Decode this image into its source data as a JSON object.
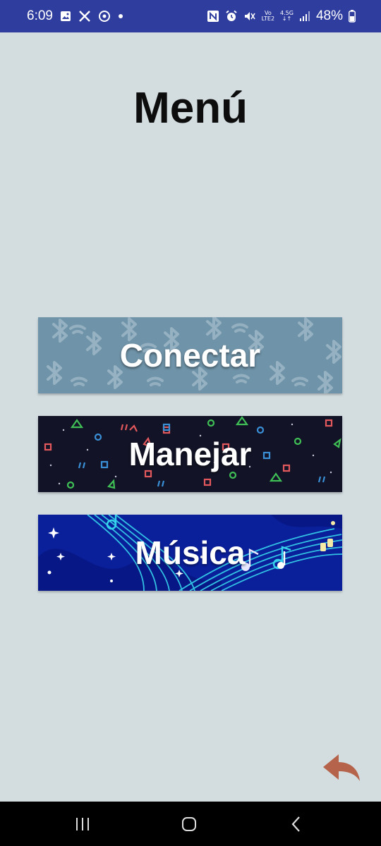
{
  "status_bar": {
    "time": "6:09",
    "battery": "48%",
    "network_top": "Vo",
    "network_bottom": "LTE2",
    "network_gen": "4.5G",
    "icons_left": [
      "gallery-icon",
      "x-app-icon",
      "sync-icon",
      "dot-icon"
    ],
    "icons_right": [
      "nfc-icon",
      "alarm-icon",
      "mute-icon",
      "network-icon",
      "signal-icon",
      "battery-icon"
    ]
  },
  "page": {
    "title": "Menú"
  },
  "menu": {
    "items": [
      {
        "label": "Conectar",
        "theme": "bluetooth-pattern"
      },
      {
        "label": "Manejar",
        "theme": "controller-symbols-pattern"
      },
      {
        "label": "Música",
        "theme": "music-notes-pattern"
      }
    ]
  },
  "colors": {
    "background": "#d3dde0",
    "status_bar": "#2f3e9e",
    "conectar_bg": "#6f93a8",
    "manejar_bg": "#121326",
    "musica_bg": "#0a1f9a",
    "back_arrow": "#b5634a"
  },
  "nav_bar": {
    "buttons": [
      "recents-icon",
      "home-icon",
      "back-icon"
    ]
  }
}
